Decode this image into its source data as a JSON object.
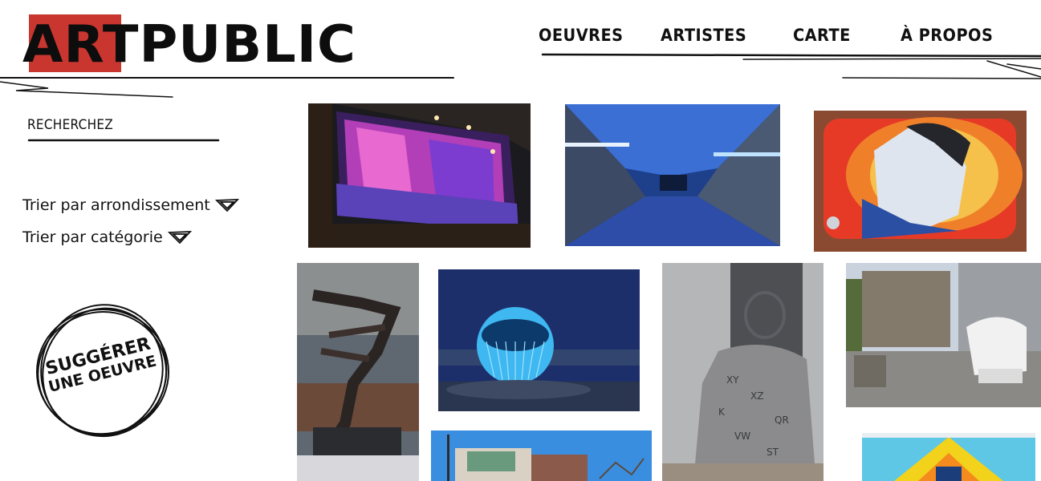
{
  "logo": {
    "part1": "ART",
    "part2": "PUBLIC",
    "accent": "#c8362f"
  },
  "nav": {
    "items": [
      {
        "label": "OEUVRES"
      },
      {
        "label": "ARTISTES"
      },
      {
        "label": "CARTE"
      },
      {
        "label": "À PROPOS"
      }
    ]
  },
  "search": {
    "label": "RECHERCHEZ"
  },
  "filters": {
    "by_borough": "Trier par arrondissement",
    "by_category": "Trier par catégorie",
    "icon": "chevron-down-triangle-icon"
  },
  "suggest": {
    "line1": "SUGGÉRER",
    "line2": "UNE OEUVRE"
  },
  "gallery": {
    "count": 10,
    "subjects": [
      "glass-light-installation",
      "blue-lit-tunnel",
      "mosaic-mural-portrait",
      "metal-bird-sculpture",
      "illuminated-sphere-sculpture",
      "letter-figure-sculpture",
      "white-fist-sculpture",
      "building-mural",
      "colorful-mural"
    ]
  }
}
